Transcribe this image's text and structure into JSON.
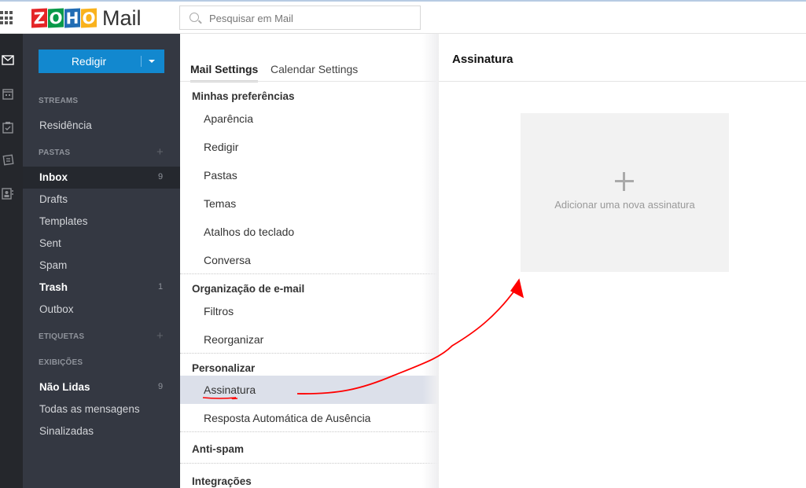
{
  "header": {
    "logo_letters": [
      "Z",
      "O",
      "H",
      "O"
    ],
    "app_name": "Mail",
    "search_placeholder": "Pesquisar em Mail"
  },
  "rail": {
    "icons": [
      "mail-icon",
      "calendar-icon",
      "tasks-icon",
      "notes-icon",
      "contacts-icon"
    ],
    "active": "mail-icon"
  },
  "sidebar": {
    "compose_label": "Redigir",
    "streams_heading": "STREAMS",
    "streams": [
      {
        "label": "Residência"
      }
    ],
    "folders_heading": "PASTAS",
    "folders": [
      {
        "label": "Inbox",
        "count": "9",
        "bold": true,
        "active": true
      },
      {
        "label": "Drafts",
        "count": ""
      },
      {
        "label": "Templates",
        "count": ""
      },
      {
        "label": "Sent",
        "count": ""
      },
      {
        "label": "Spam",
        "count": ""
      },
      {
        "label": "Trash",
        "count": "1",
        "bold": true
      },
      {
        "label": "Outbox",
        "count": ""
      }
    ],
    "tags_heading": "ETIQUETAS",
    "views_heading": "EXIBIÇÕES",
    "views": [
      {
        "label": "Não Lidas",
        "count": "9",
        "bold": true
      },
      {
        "label": "Todas as mensagens",
        "count": ""
      },
      {
        "label": "Sinalizadas",
        "count": ""
      }
    ]
  },
  "settings": {
    "tabs": [
      {
        "label": "Mail Settings",
        "active": true
      },
      {
        "label": "Calendar Settings",
        "active": false
      }
    ],
    "groups": [
      {
        "heading": "Minhas preferências",
        "items": [
          "Aparência",
          "Redigir",
          "Pastas",
          "Temas",
          "Atalhos do teclado",
          "Conversa"
        ]
      },
      {
        "heading": "Organização de e-mail",
        "items": [
          "Filtros",
          "Reorganizar"
        ]
      },
      {
        "heading": "Personalizar",
        "items": [
          "Assinatura",
          "Resposta Automática de Ausência"
        ],
        "active_item": "Assinatura"
      },
      {
        "heading": "Anti-spam",
        "items": []
      },
      {
        "heading": "Integrações",
        "items": []
      }
    ]
  },
  "panel": {
    "title": "Assinatura",
    "add_signature_label": "Adicionar uma nova assinatura"
  },
  "annotation": {
    "color": "#ff0000",
    "description": "red hand-drawn arrow from Assinatura to add-signature card"
  }
}
